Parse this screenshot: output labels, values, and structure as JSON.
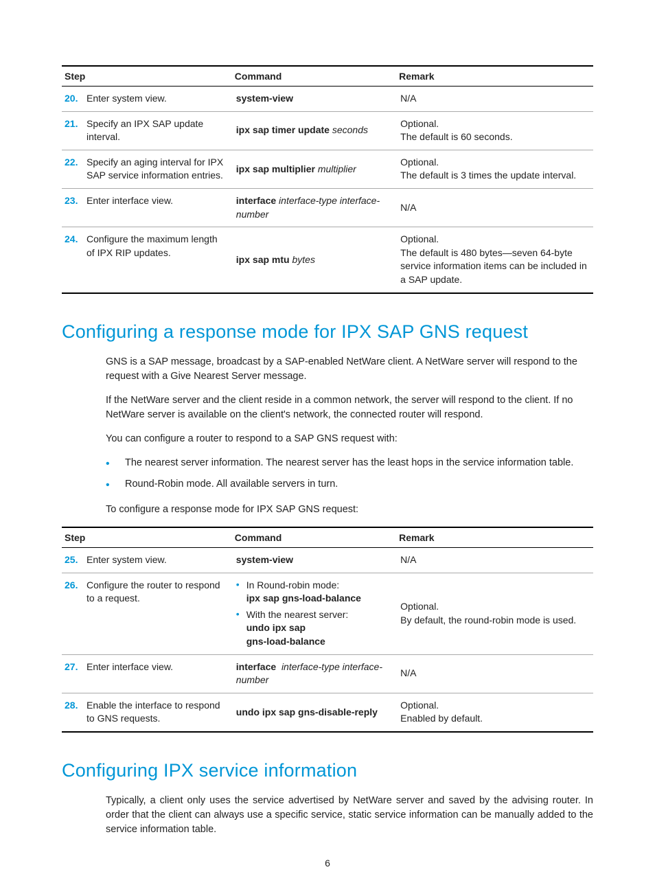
{
  "table1": {
    "headers": {
      "step": "Step",
      "command": "Command",
      "remark": "Remark"
    },
    "rows": {
      "r20": {
        "num": "20.",
        "step": "Enter system view.",
        "cmd_bold": "system-view",
        "remark": "N/A"
      },
      "r21": {
        "num": "21.",
        "step": "Specify an IPX SAP update interval.",
        "cmd_bold": "ipx sap timer update",
        "cmd_ital": "seconds",
        "remark_l1": "Optional.",
        "remark_l2": "The default is 60 seconds."
      },
      "r22": {
        "num": "22.",
        "step": "Specify an aging interval for IPX SAP service information entries.",
        "cmd_bold": "ipx sap multiplier",
        "cmd_ital": "multiplier",
        "remark_l1": "Optional.",
        "remark_l2": "The default is 3 times the update interval."
      },
      "r23": {
        "num": "23.",
        "step": "Enter interface view.",
        "cmd_bold": "interface",
        "cmd_ital": "interface-type interface-number",
        "remark": "N/A"
      },
      "r24": {
        "num": "24.",
        "step": "Configure the maximum length of IPX RIP updates.",
        "cmd_bold": "ipx sap mtu",
        "cmd_ital": "bytes",
        "remark_l1": "Optional.",
        "remark_l2": "The default is 480 bytes—seven 64-byte service information items can be included in a SAP update."
      }
    }
  },
  "section1": {
    "heading": "Configuring a response mode for IPX SAP GNS request",
    "p1": "GNS is a SAP message, broadcast by a SAP-enabled NetWare client. A NetWare server will respond to the request with a Give Nearest Server message.",
    "p2": "If the NetWare server and the client reside in a common network, the server will respond to the client. If no NetWare server is available on the client's network, the connected router will respond.",
    "p3": "You can configure a router to respond to a SAP GNS request with:",
    "li1": "The nearest server information. The nearest server has the least hops in the service information table.",
    "li2": "Round-Robin mode. All available servers in turn.",
    "p4": "To configure a response mode for IPX SAP GNS request:"
  },
  "table2": {
    "headers": {
      "step": "Step",
      "command": "Command",
      "remark": "Remark"
    },
    "rows": {
      "r25": {
        "num": "25.",
        "step": "Enter system view.",
        "cmd_bold": "system-view",
        "remark": "N/A"
      },
      "r26": {
        "num": "26.",
        "step": "Configure the router to respond to a request.",
        "b1_intro": "In Round-robin mode:",
        "b1_bold": "ipx sap gns-load-balance",
        "b2_intro": "With the nearest server:",
        "b2_bold1": "undo ipx sap",
        "b2_bold2": "gns-load-balance",
        "remark_l1": "Optional.",
        "remark_l2": "By default, the round-robin mode is used."
      },
      "r27": {
        "num": "27.",
        "step": "Enter interface view.",
        "cmd_bold": "interface",
        "cmd_ital": "interface-type interface-number",
        "remark": "N/A"
      },
      "r28": {
        "num": "28.",
        "step": "Enable the interface to respond to GNS requests.",
        "cmd_bold": "undo ipx sap gns-disable-reply",
        "remark_l1": "Optional.",
        "remark_l2": "Enabled by default."
      }
    }
  },
  "section2": {
    "heading": "Configuring IPX service information",
    "p1": "Typically, a client only uses the service advertised by NetWare server and saved by the advising router. In order that the client can always use a specific service, static service information can be manually added to the service information table."
  },
  "pagenum": "6"
}
